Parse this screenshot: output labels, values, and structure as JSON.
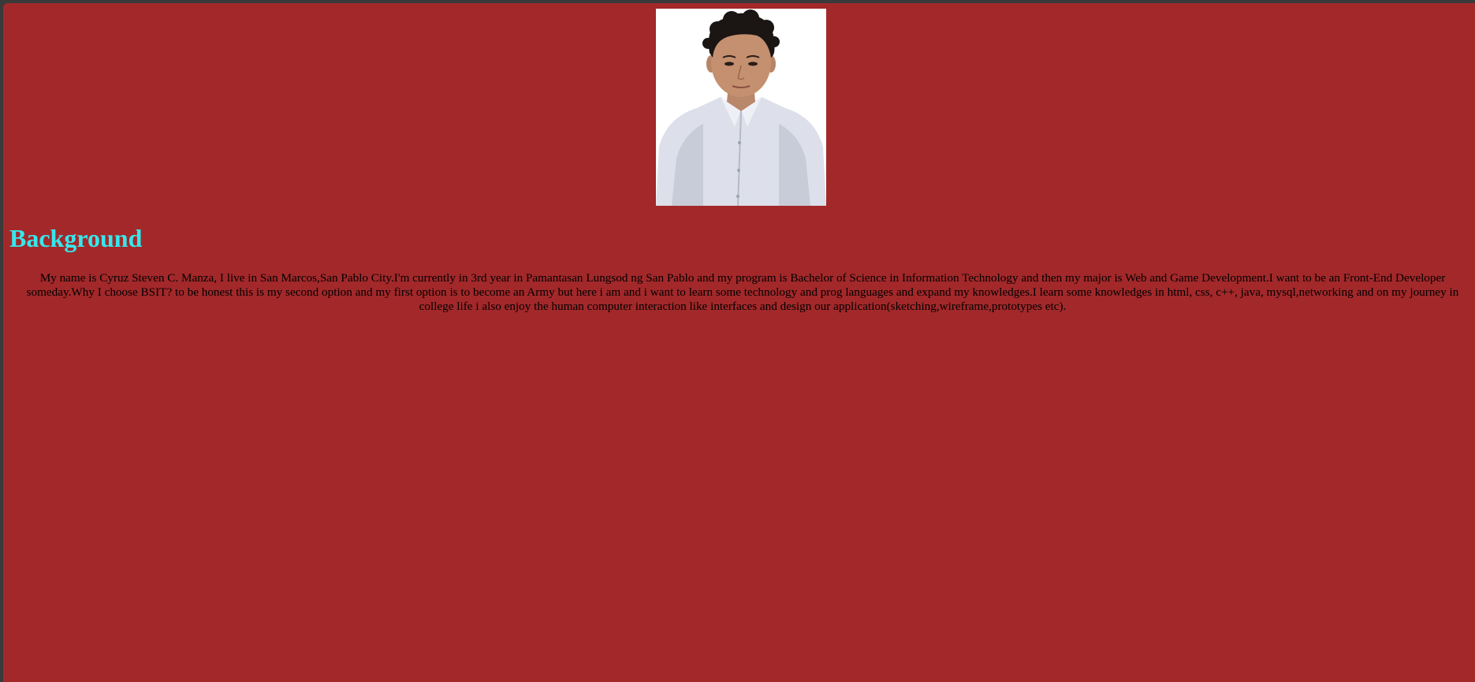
{
  "profile": {
    "photo_icon": "portrait-photo",
    "heading": "Background",
    "bio": "My name is Cyruz Steven C. Manza, I live in San Marcos,San Pablo City.I'm currently in 3rd year in Pamantasan Lungsod ng San Pablo and my program is Bachelor of Science in Information Technology and then my major is Web and Game Development.I want to be an Front-End Developer someday.Why I choose BSIT? to be honest this is my second option and my first option is to become an Army but here i am and i want to learn some technology and prog languages and expand my knowledges.I learn some knowledges in html, css, c++, java, mysql,networking and on my journey in college life i also enjoy the human computer interaction like interfaces and design our application(sketching,wireframe,prototypes etc)."
  },
  "colors": {
    "page_background": "#a3282a",
    "heading": "#35e8ec",
    "body_text": "#000000",
    "window_border": "#3a3a3a"
  }
}
